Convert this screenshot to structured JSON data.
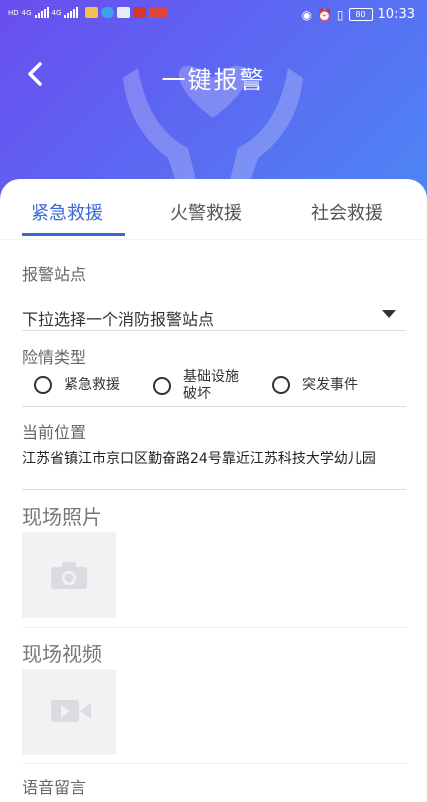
{
  "status_bar": {
    "left_labels": [
      "HD",
      "4G",
      "4G"
    ],
    "time": "10:33",
    "battery": "80"
  },
  "header": {
    "title": "一键报警"
  },
  "tabs": [
    {
      "label": "紧急救援",
      "active": true
    },
    {
      "label": "火警救援",
      "active": false
    },
    {
      "label": "社会救援",
      "active": false
    }
  ],
  "form": {
    "station_label": "报警站点",
    "station_placeholder": "下拉选择一个消防报警站点",
    "danger_type_label": "险情类型",
    "danger_options": [
      {
        "label": "紧急救援",
        "selected": false
      },
      {
        "label": "基础设施破坏",
        "line1": "基础设施",
        "line2": "破坏",
        "selected": false
      },
      {
        "label": "突发事件",
        "selected": false
      }
    ],
    "location_label": "当前位置",
    "location_value": "江苏省镇江市京口区勤奋路24号靠近江苏科技大学幼儿园",
    "photo_label": "现场照片",
    "video_label": "现场视频",
    "voice_label": "语音留言"
  },
  "icons": {
    "back": "chevron-left-icon",
    "dropdown": "caret-down-icon",
    "photo": "camera-icon",
    "video": "video-camera-icon",
    "header_art": "hands-heart-icon"
  },
  "colors": {
    "accent": "#3d67d8",
    "header_gradient_start": "#6a4df0",
    "header_gradient_end": "#4c86f4"
  }
}
